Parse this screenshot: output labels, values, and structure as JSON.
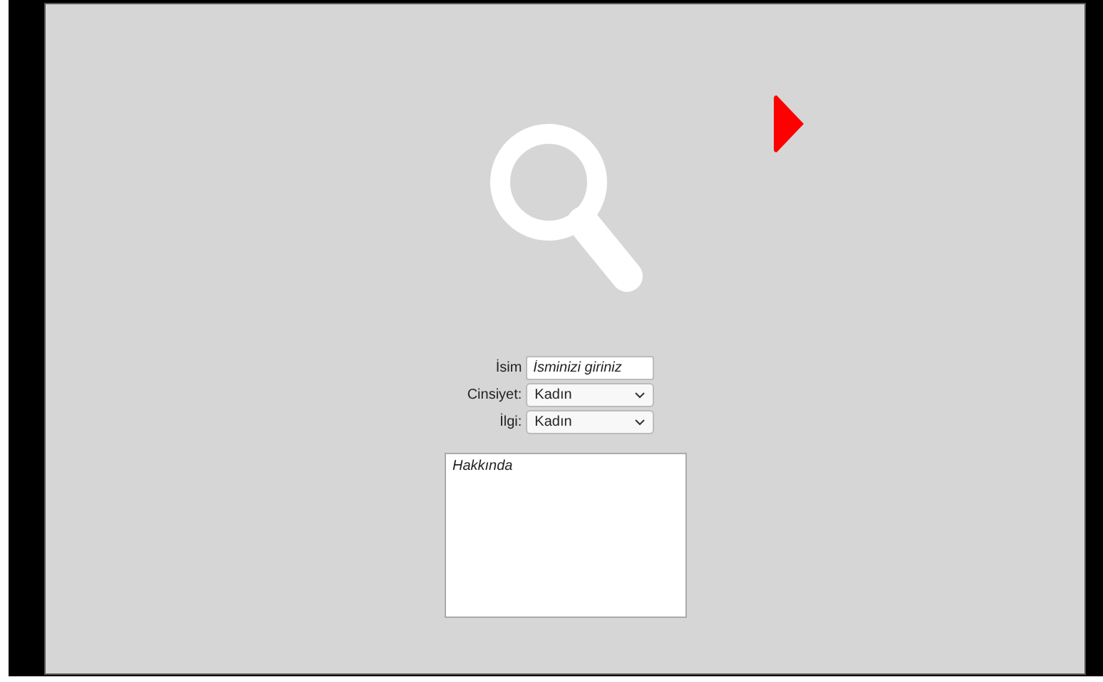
{
  "form": {
    "fields": [
      {
        "label": "İsim",
        "kind": "text",
        "placeholder": "İsminizi giriniz"
      },
      {
        "label": "Cinsiyet:",
        "kind": "select",
        "value": "Kadın"
      },
      {
        "label": "İlgi:",
        "kind": "select",
        "value": "Kadın"
      }
    ],
    "about": {
      "placeholder": "Hakkında"
    }
  }
}
